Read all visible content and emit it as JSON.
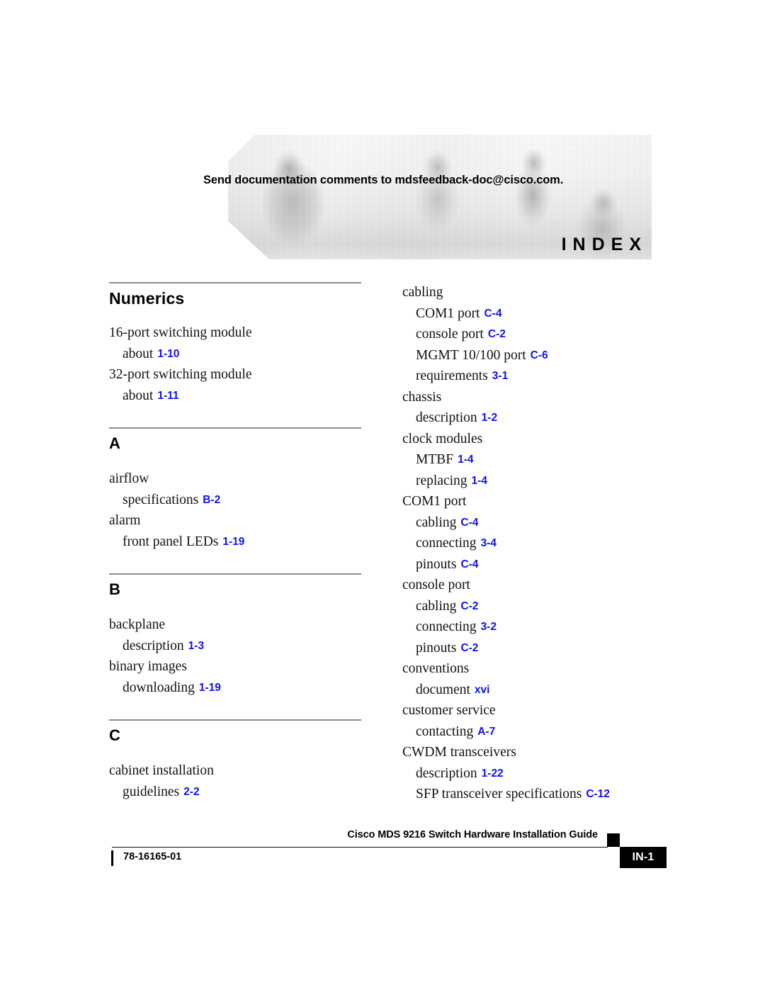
{
  "header": {
    "feedback_line": "Send documentation comments to mdsfeedback-doc@cisco.com.",
    "index_label": "INDEX"
  },
  "index": {
    "left_column": [
      {
        "heading": "Numerics",
        "has_rule": true,
        "entries": [
          {
            "level": 1,
            "text": "16-port switching module",
            "page": ""
          },
          {
            "level": 2,
            "text": "about",
            "page": "1-10"
          },
          {
            "level": 1,
            "text": "32-port switching module",
            "page": ""
          },
          {
            "level": 2,
            "text": "about",
            "page": "1-11"
          }
        ]
      },
      {
        "heading": "A",
        "has_rule": true,
        "entries": [
          {
            "level": 1,
            "text": "airflow",
            "page": ""
          },
          {
            "level": 2,
            "text": "specifications",
            "page": "B-2"
          },
          {
            "level": 1,
            "text": "alarm",
            "page": ""
          },
          {
            "level": 2,
            "text": "front panel LEDs",
            "page": "1-19"
          }
        ]
      },
      {
        "heading": "B",
        "has_rule": true,
        "entries": [
          {
            "level": 1,
            "text": "backplane",
            "page": ""
          },
          {
            "level": 2,
            "text": "description",
            "page": "1-3"
          },
          {
            "level": 1,
            "text": "binary images",
            "page": ""
          },
          {
            "level": 2,
            "text": "downloading",
            "page": "1-19"
          }
        ]
      },
      {
        "heading": "C",
        "has_rule": true,
        "entries": [
          {
            "level": 1,
            "text": "cabinet installation",
            "page": ""
          },
          {
            "level": 2,
            "text": "guidelines",
            "page": "2-2"
          }
        ]
      }
    ],
    "right_column": [
      {
        "heading": "",
        "has_rule": false,
        "entries": [
          {
            "level": 1,
            "text": "cabling",
            "page": ""
          },
          {
            "level": 2,
            "text": "COM1 port",
            "page": "C-4"
          },
          {
            "level": 2,
            "text": "console port",
            "page": "C-2"
          },
          {
            "level": 2,
            "text": "MGMT 10/100 port",
            "page": "C-6"
          },
          {
            "level": 2,
            "text": "requirements",
            "page": "3-1"
          },
          {
            "level": 1,
            "text": "chassis",
            "page": ""
          },
          {
            "level": 2,
            "text": "description",
            "page": "1-2"
          },
          {
            "level": 1,
            "text": "clock modules",
            "page": ""
          },
          {
            "level": 2,
            "text": "MTBF",
            "page": "1-4"
          },
          {
            "level": 2,
            "text": "replacing",
            "page": "1-4"
          },
          {
            "level": 1,
            "text": "COM1 port",
            "page": ""
          },
          {
            "level": 2,
            "text": "cabling",
            "page": "C-4"
          },
          {
            "level": 2,
            "text": "connecting",
            "page": "3-4"
          },
          {
            "level": 2,
            "text": "pinouts",
            "page": "C-4"
          },
          {
            "level": 1,
            "text": "console port",
            "page": ""
          },
          {
            "level": 2,
            "text": "cabling",
            "page": "C-2"
          },
          {
            "level": 2,
            "text": "connecting",
            "page": "3-2"
          },
          {
            "level": 2,
            "text": "pinouts",
            "page": "C-2"
          },
          {
            "level": 1,
            "text": "conventions",
            "page": ""
          },
          {
            "level": 2,
            "text": "document",
            "page": "xvi"
          },
          {
            "level": 1,
            "text": "customer service",
            "page": ""
          },
          {
            "level": 2,
            "text": "contacting",
            "page": "A-7"
          },
          {
            "level": 1,
            "text": "CWDM transceivers",
            "page": ""
          },
          {
            "level": 2,
            "text": "description",
            "page": "1-22"
          },
          {
            "level": 2,
            "text": "SFP transceiver specifications",
            "page": "C-12"
          }
        ]
      }
    ]
  },
  "footer": {
    "guide_title": "Cisco MDS 9216 Switch Hardware Installation Guide",
    "document_number": "78-16165-01",
    "page_number": "IN-1"
  },
  "colors": {
    "page_reference_blue": "#0f14e6",
    "rule_gray": "#8d8d8d",
    "text_black": "#111111"
  }
}
